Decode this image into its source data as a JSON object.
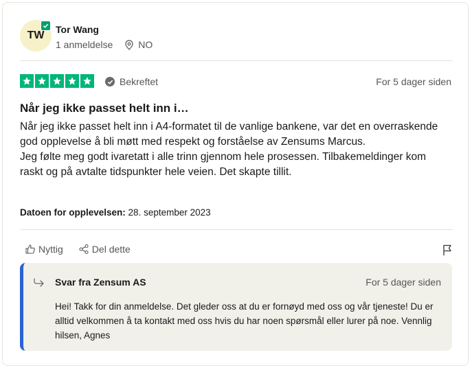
{
  "reviewer": {
    "initials": "TW",
    "name": "Tor Wang",
    "review_count": "1 anmeldelse",
    "country": "NO"
  },
  "review": {
    "rating": 5,
    "verified_label": "Bekreftet",
    "posted": "For 5 dager siden",
    "title": "Når jeg ikke passet helt inn i…",
    "paragraphs": [
      "Når jeg ikke passet helt inn i A4-formatet til de vanlige bankene, var det en overraskende god opplevelse å bli møtt med respekt og forståelse av Zensums Marcus.",
      "Jeg følte meg godt ivaretatt i alle trinn gjennom hele prosessen. Tilbakemeldinger kom raskt og på avtalte tidspunkter hele veien. Det skapte tillit."
    ],
    "experience_label": "Datoen for opplevelsen:",
    "experience_date": "28. september 2023"
  },
  "actions": {
    "useful_label": "Nyttig",
    "share_label": "Del dette"
  },
  "reply": {
    "title": "Svar fra Zensum AS",
    "posted": "For 5 dager siden",
    "text": "Hei! Takk for din anmeldelse. Det gleder oss at du er fornøyd med oss og vår tjeneste! Du er alltid velkommen å ta kontakt med oss hvis du har noen spørsmål eller lurer på noe. Vennlig hilsen, Agnes"
  },
  "colors": {
    "star_green": "#00b67a",
    "verified_badge": "#04a16a",
    "reply_accent": "#2b63d8",
    "reply_background": "#f1f1ea",
    "avatar_background": "#f6f1c8"
  },
  "icons": [
    "checkmark-icon",
    "location-pin-icon",
    "star-icon",
    "verified-check-icon",
    "thumbs-up-icon",
    "share-icon",
    "flag-icon",
    "reply-arrow-icon"
  ]
}
